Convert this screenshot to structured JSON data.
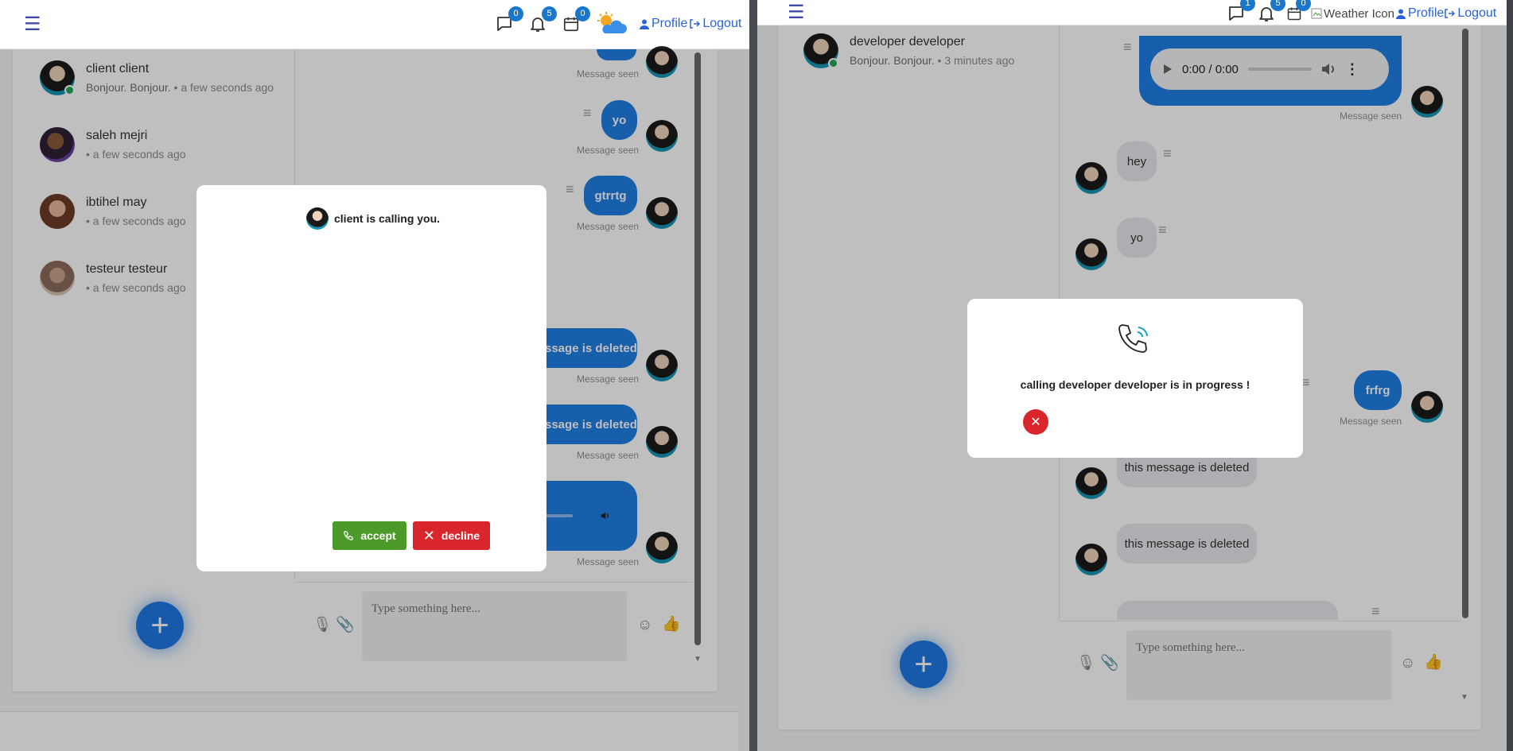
{
  "left": {
    "nav": {
      "messages_badge": "0",
      "notifications_badge": "5",
      "calendar_badge": "0",
      "profile": "Profile",
      "logout": "Logout"
    },
    "contacts": [
      {
        "name": "client client",
        "preview": "Bonjour. Bonjour.",
        "time": "• a few seconds ago"
      },
      {
        "name": "saleh mejri",
        "preview": "",
        "time": "• a few seconds ago"
      },
      {
        "name": "ibtihel may",
        "preview": "",
        "time": "• a few seconds ago"
      },
      {
        "name": "testeur testeur",
        "preview": "",
        "time": "• a few seconds ago"
      }
    ],
    "messages": [
      {
        "text": "",
        "status": "Message seen"
      },
      {
        "text": "yo",
        "status": "Message seen"
      },
      {
        "text": "gtrrtg",
        "status": "Message seen"
      },
      {
        "text": "ssage is deleted",
        "status": "Message seen"
      },
      {
        "text": "ssage is deleted",
        "status": "Message seen"
      },
      {
        "text": "",
        "status": "Message seen"
      }
    ],
    "composer_placeholder": "Type something here...",
    "call_modal": {
      "text": "client is calling you.",
      "accept": "accept",
      "decline": "decline"
    }
  },
  "right": {
    "nav": {
      "messages_badge": "1",
      "notifications_badge": "5",
      "calendar_badge": "0",
      "weather_alt": "Weather Icon",
      "profile": "Profile",
      "logout": "Logout"
    },
    "contact": {
      "name": "developer developer",
      "preview": "Bonjour. Bonjour.",
      "time": "• 3 minutes ago"
    },
    "audio_time": "0:00 / 0:00",
    "messages": [
      {
        "text": "hey"
      },
      {
        "text": "yo"
      },
      {
        "text": "frfrg",
        "status": "Message seen"
      },
      {
        "text": "this message is deleted"
      },
      {
        "text": "this message is deleted"
      }
    ],
    "audio_status": "Message seen",
    "composer_placeholder": "Type something here...",
    "calling_modal": {
      "text": "calling developer developer is in progress !"
    }
  },
  "colors": {
    "accent": "#1f7ee4",
    "accept": "#4c9a2a",
    "decline": "#d9262d",
    "nav_link": "#2a63d6"
  }
}
